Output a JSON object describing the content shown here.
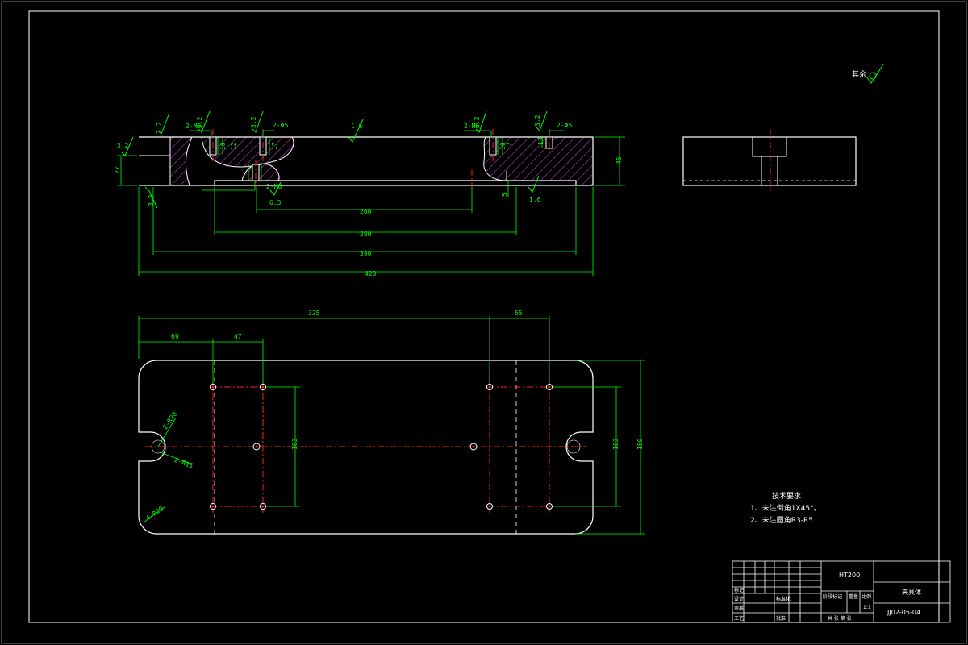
{
  "colors": {
    "background": "#000000",
    "outline": "#ffffff",
    "dimension": "#00ff00",
    "centerline": "#ff2020",
    "hatch": "#b040c0",
    "hole": "#ffffff"
  },
  "dimensions": {
    "len_420": "420",
    "len_390": "390",
    "len_280": "280",
    "len_200": "200",
    "h_45": "45",
    "h_27": "27",
    "h_5": "5",
    "top_325": "325",
    "top_55": "55",
    "top_69": "69",
    "top_47": "47",
    "v_103_left": "103",
    "v_103_right": "103",
    "v_150": "150"
  },
  "callouts": {
    "m5_left": "2-M5",
    "phi5_left": "2-Φ5",
    "m5_right": "2-M5",
    "phi5_right": "2-Φ5",
    "m6_bottom": "2-M6",
    "r20_slot": "2-R20",
    "r15_slot": "2-R15",
    "r20_corner": "4-R20",
    "depth_10a": "10",
    "depth_12a": "12",
    "depth_17": "17",
    "depth_10b": "10",
    "depth_12b": "12",
    "depth_13": "13"
  },
  "roughness": {
    "r_16_top": "1.6",
    "r_16_right": "1.6",
    "r_32_a": "3.2",
    "r_32_b": "3.2",
    "r_32_c": "3.2",
    "r_32_d": "3.2",
    "r_32_e": "3.2",
    "r_32_f": "3.2",
    "r_63": "6.3",
    "r_32_left": "3.2",
    "r_32_bottom": "3.2",
    "general_label": "其余"
  },
  "notes": {
    "title": "技术要求",
    "line1": "1、未注倒角1X45°。",
    "line2": "2、未注圆角R3-R5."
  },
  "title_block": {
    "material": "HT200",
    "part_name": "夹具体",
    "drawing_no": "JJ02-05-04",
    "scale": "1:1",
    "row_marks": "标记",
    "row_design": "设计",
    "row_check": "审核",
    "row_process": "工艺",
    "row_std": "标准化",
    "row_approve": "批准",
    "stage_label": "阶段标记",
    "weight_label": "重量",
    "scale_label": "比例",
    "sheets": "共 张 第 张"
  }
}
